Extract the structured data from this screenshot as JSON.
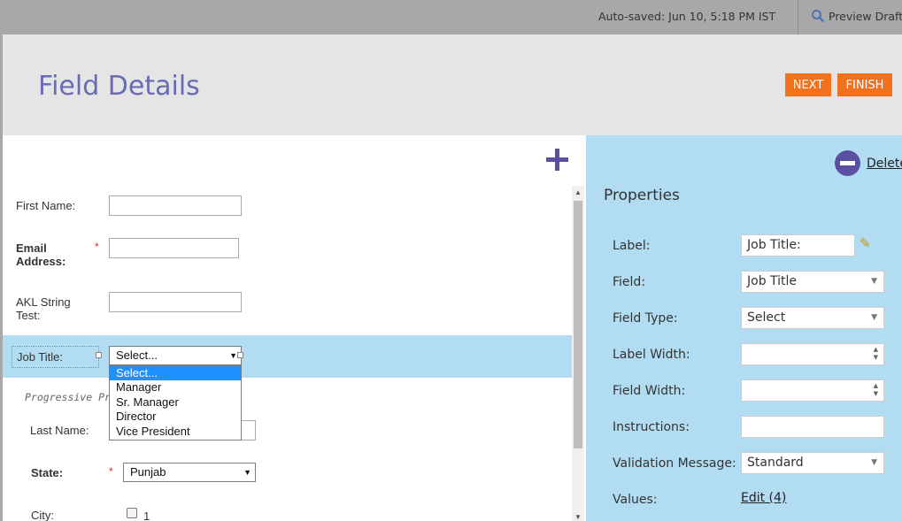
{
  "topbar": {
    "autosaved": "Auto-saved: Jun 10, 5:18 PM IST",
    "preview_label": "Preview Draft",
    "preview_icon": "magnifier-icon"
  },
  "header": {
    "title": "Field Details",
    "next_label": "NEXT",
    "finish_label": "FINISH",
    "accent": "#f2711c",
    "title_color": "#6b6bb3"
  },
  "form": {
    "first_name_label": "First Name:",
    "email_label": "Email Address:",
    "akl_label": "AKL String Test:",
    "job_title_label": "Job Title:",
    "job_title_select_value": "Select...",
    "dropdown_options": [
      "Select...",
      "Manager",
      "Sr. Manager",
      "Director",
      "Vice President"
    ],
    "progressive_text": "Progressive Pr",
    "last_name_label": "Last Name:",
    "state_label": "State:",
    "state_value": "Punjab",
    "city_label": "City:",
    "city_checkbox_label": "1",
    "required_mark": "*"
  },
  "properties": {
    "delete_label": "Delete",
    "title": "Properties",
    "label_label": "Label:",
    "label_value": "Job Title:",
    "field_label": "Field:",
    "field_value": "Job Title",
    "field_type_label": "Field Type:",
    "field_type_value": "Select",
    "label_width_label": "Label Width:",
    "label_width_value": "",
    "field_width_label": "Field Width:",
    "field_width_value": "",
    "instructions_label": "Instructions:",
    "instructions_value": "",
    "validation_label": "Validation Message:",
    "validation_value": "Standard",
    "values_label": "Values:",
    "values_link": "Edit (4)",
    "panel_color": "#b2dcf2"
  }
}
